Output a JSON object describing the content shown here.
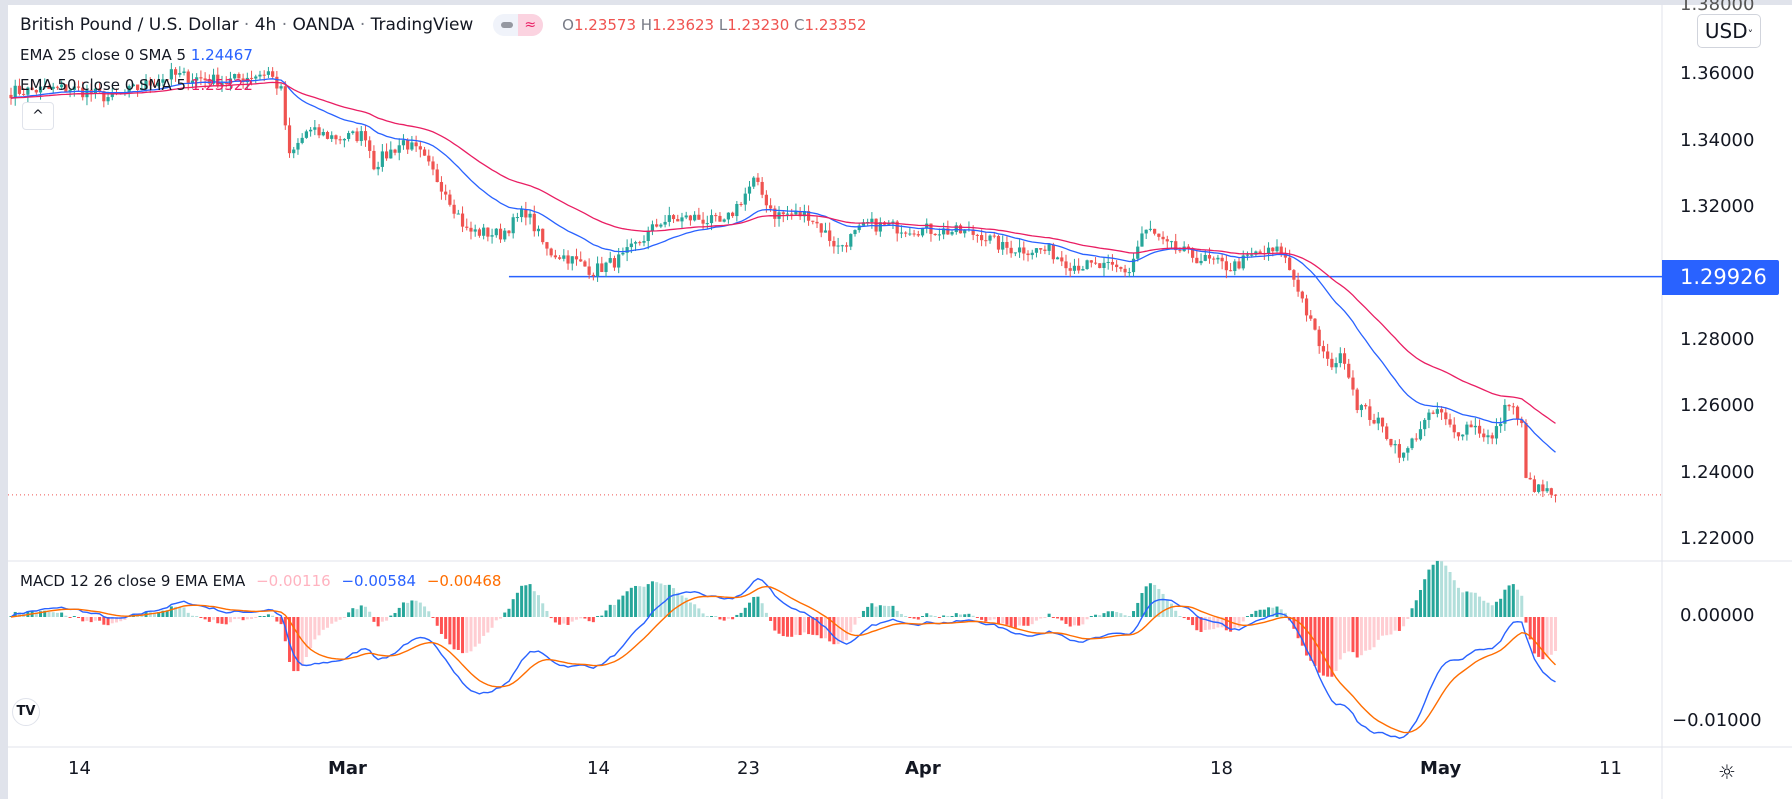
{
  "header": {
    "symbol": "British Pound / U.S. Dollar",
    "interval": "4h",
    "exchange": "OANDA",
    "source": "TradingView",
    "sep": "·",
    "sync_icon": "≈",
    "ohlc": {
      "o_label": "O",
      "o": "1.23573",
      "h_label": "H",
      "h": "1.23623",
      "l_label": "L",
      "l": "1.23230",
      "c_label": "C",
      "c": "1.23352"
    }
  },
  "indicators": {
    "ema25": {
      "label": "EMA 25 close 0 SMA 5",
      "value": "1.24467",
      "color": "#2962ff"
    },
    "ema50": {
      "label": "EMA 50 close 0 SMA 5",
      "value": "1.25322",
      "color": "#e91e63"
    },
    "macd": {
      "label": "MACD 12 26 close 9 EMA EMA",
      "hist": "−0.00116",
      "macd": "−0.00584",
      "signal": "−0.00468"
    }
  },
  "collapse_icon": "^",
  "price_axis": {
    "currency": "USD",
    "ticks": [
      "1.38000",
      "1.36000",
      "1.34000",
      "1.32000",
      "1.28000",
      "1.26000",
      "1.24000",
      "1.22000"
    ],
    "hline_label": "1.29926"
  },
  "macd_axis": {
    "ticks": [
      "0.00000",
      "−0.01000"
    ]
  },
  "time_axis": {
    "ticks": [
      "14",
      "Mar",
      "14",
      "23",
      "Apr",
      "18",
      "May",
      "11"
    ]
  },
  "logo": "TV",
  "settings_icon": "☼",
  "chart_data": {
    "type": "candlestick",
    "title": "British Pound / U.S. Dollar · 4h · OANDA",
    "ylim": [
      1.22,
      1.38
    ],
    "horizontal_line": 1.29926,
    "last_close": 1.23352,
    "colors": {
      "up": "#26a69a",
      "down": "#ef5350",
      "ema25": "#2962ff",
      "ema50": "#e91e63",
      "macd": "#2962ff",
      "signal": "#ff6d00",
      "hist_up_strong": "#26a69a",
      "hist_up_weak": "#b2dfdb",
      "hist_dn_strong": "#ff5252",
      "hist_dn_weak": "#ffcdd2"
    },
    "close_path_bar_price": [
      [
        0,
        1.355
      ],
      [
        14,
        1.356
      ],
      [
        24,
        1.353
      ],
      [
        38,
        1.36
      ],
      [
        51,
        1.358
      ],
      [
        61,
        1.361
      ],
      [
        64,
        1.355
      ],
      [
        66,
        1.335
      ],
      [
        70,
        1.343
      ],
      [
        78,
        1.341
      ],
      [
        84,
        1.342
      ],
      [
        86,
        1.333
      ],
      [
        93,
        1.34
      ],
      [
        97,
        1.336
      ],
      [
        103,
        1.325
      ],
      [
        108,
        1.313
      ],
      [
        116,
        1.312
      ],
      [
        122,
        1.319
      ],
      [
        127,
        1.307
      ],
      [
        132,
        1.305
      ],
      [
        138,
        1.301
      ],
      [
        145,
        1.305
      ],
      [
        150,
        1.311
      ],
      [
        154,
        1.316
      ],
      [
        162,
        1.317
      ],
      [
        169,
        1.315
      ],
      [
        176,
        1.328
      ],
      [
        181,
        1.318
      ],
      [
        189,
        1.318
      ],
      [
        196,
        1.308
      ],
      [
        203,
        1.315
      ],
      [
        211,
        1.314
      ],
      [
        222,
        1.313
      ],
      [
        230,
        1.312
      ],
      [
        235,
        1.308
      ],
      [
        246,
        1.307
      ],
      [
        251,
        1.303
      ],
      [
        259,
        1.302
      ],
      [
        265,
        1.301
      ],
      [
        268,
        1.312
      ],
      [
        270,
        1.313
      ],
      [
        273,
        1.309
      ],
      [
        281,
        1.305
      ],
      [
        289,
        1.302
      ],
      [
        295,
        1.306
      ],
      [
        301,
        1.307
      ],
      [
        305,
        1.296
      ],
      [
        308,
        1.285
      ],
      [
        312,
        1.273
      ],
      [
        316,
        1.275
      ],
      [
        319,
        1.261
      ],
      [
        324,
        1.255
      ],
      [
        330,
        1.245
      ],
      [
        334,
        1.254
      ],
      [
        338,
        1.259
      ],
      [
        342,
        1.252
      ],
      [
        346,
        1.255
      ],
      [
        351,
        1.25
      ],
      [
        355,
        1.262
      ],
      [
        358,
        1.254
      ],
      [
        359,
        1.238
      ],
      [
        362,
        1.235
      ],
      [
        366,
        1.2335
      ]
    ]
  }
}
